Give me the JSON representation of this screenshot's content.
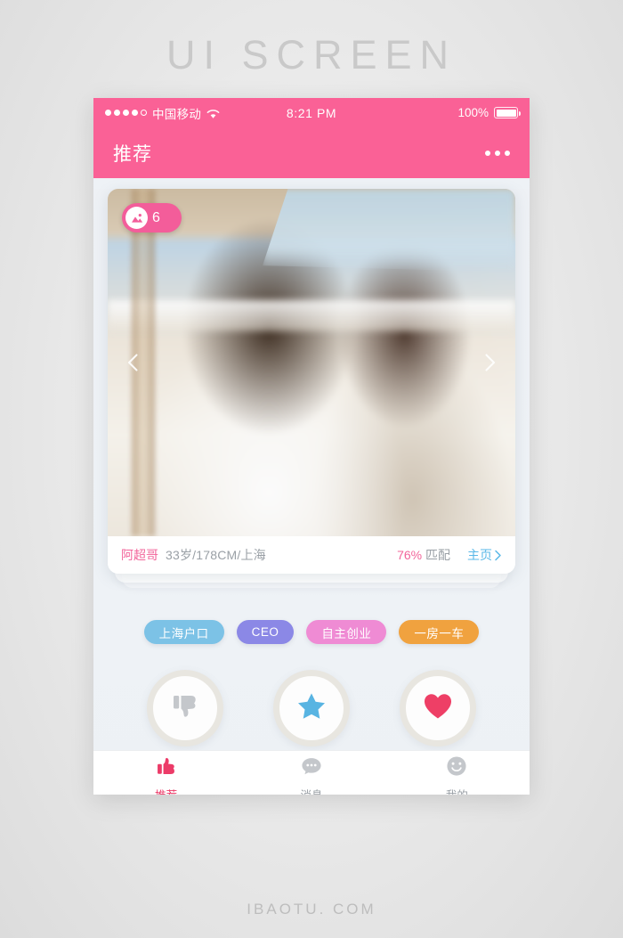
{
  "watermarks": {
    "top": "UI SCREEN",
    "bottom": "IBAOTU. COM"
  },
  "statusbar": {
    "signal_dots_filled": 4,
    "signal_dots_total": 5,
    "carrier": "中国移动",
    "wifi_icon": "wifi-icon",
    "time": "8:21 PM",
    "battery_percent": "100%",
    "battery_icon": "battery-full-icon"
  },
  "navbar": {
    "title": "推荐",
    "more_icon": "more-horizontal-icon"
  },
  "card": {
    "photo_badge": {
      "icon": "image-icon",
      "count": "6"
    },
    "prev_icon": "chevron-left-icon",
    "next_icon": "chevron-right-icon",
    "info": {
      "name": "阿超哥",
      "meta": "33岁/178CM/上海",
      "match_percent": "76%",
      "match_label": "匹配",
      "homepage_label": "主页",
      "homepage_icon": "chevron-right-icon"
    }
  },
  "tags": [
    {
      "label": "上海户口",
      "color": "#7cc2e6"
    },
    {
      "label": "CEO",
      "color": "#8b88e6"
    },
    {
      "label": "自主创业",
      "color": "#ef8bd4"
    },
    {
      "label": "一房一车",
      "color": "#f0a23f"
    }
  ],
  "actions": [
    {
      "label": "不喜欢",
      "icon": "thumbs-down-icon",
      "color": "#c4c7cb"
    },
    {
      "label": "待定",
      "icon": "star-icon",
      "color": "#58b4e2"
    },
    {
      "label": "喜欢",
      "icon": "heart-icon",
      "color": "#ee3f66"
    }
  ],
  "tabbar": [
    {
      "label": "推荐",
      "icon": "thumbs-up-icon",
      "active": true,
      "color": "#ec3b68"
    },
    {
      "label": "消息",
      "icon": "chat-bubble-icon",
      "active": false,
      "color": "#c4c7cb"
    },
    {
      "label": "我的",
      "icon": "smiley-face-icon",
      "active": false,
      "color": "#c4c7cb"
    }
  ],
  "colors": {
    "brand_pink": "#fa6196",
    "accent_blue": "#5ab8e8",
    "background": "#eef2f6"
  }
}
